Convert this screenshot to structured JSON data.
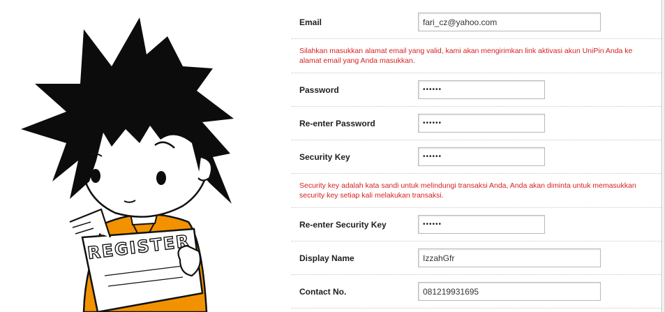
{
  "mascot": {
    "sign_text": "REGISTER"
  },
  "form": {
    "email": {
      "label": "Email",
      "value": "fari_cz@yahoo.com"
    },
    "email_note": "Silahkan masukkan alamat email yang valid, kami akan mengirimkan link aktivasi akun UniPin Anda ke alamat email yang Anda masukkan.",
    "password": {
      "label": "Password",
      "value": "••••••"
    },
    "reenter_password": {
      "label": "Re-enter Password",
      "value": "••••••"
    },
    "security_key": {
      "label": "Security Key",
      "value": "••••••"
    },
    "security_note": "Security key adalah kata sandi untuk melindungi transaksi Anda, Anda akan diminta untuk memasukkan security key setiap kali melakukan transaksi.",
    "reenter_security_key": {
      "label": "Re-enter Security Key",
      "value": "••••••"
    },
    "display_name": {
      "label": "Display Name",
      "value": "IzzahGfr"
    },
    "contact_no": {
      "label": "Contact No.",
      "value": "081219931695"
    }
  },
  "colors": {
    "note_red": "#d61f1f",
    "shirt_orange": "#f39200",
    "label_dark": "#1e1e1e"
  }
}
